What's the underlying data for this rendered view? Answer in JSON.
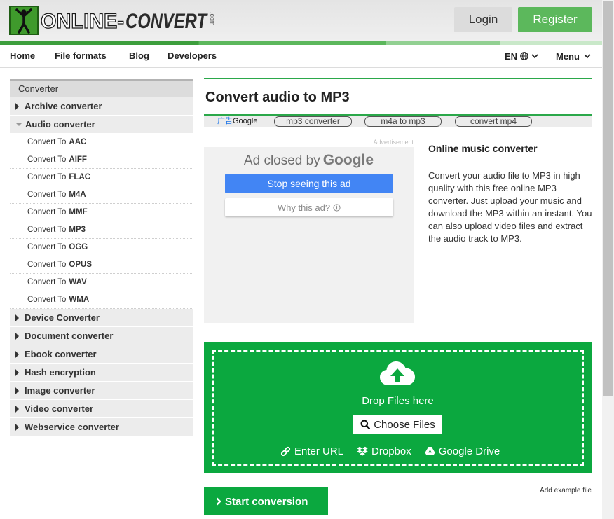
{
  "header": {
    "logo_main": "ONLINE-",
    "logo_brand": "CONVERT",
    "logo_tld": ".com",
    "login": "Login",
    "register": "Register"
  },
  "nav": {
    "home": "Home",
    "file_formats": "File formats",
    "blog": "Blog",
    "developers": "Developers",
    "language": "EN",
    "menu": "Menu"
  },
  "sidebar": {
    "title": "Converter",
    "categories": [
      {
        "label": "Archive converter",
        "expanded": false
      },
      {
        "label": "Audio converter",
        "expanded": true,
        "items": [
          {
            "prefix": "Convert To",
            "format": "AAC"
          },
          {
            "prefix": "Convert To",
            "format": "AIFF"
          },
          {
            "prefix": "Convert To",
            "format": "FLAC"
          },
          {
            "prefix": "Convert To",
            "format": "M4A"
          },
          {
            "prefix": "Convert To",
            "format": "MMF"
          },
          {
            "prefix": "Convert To",
            "format": "MP3"
          },
          {
            "prefix": "Convert To",
            "format": "OGG"
          },
          {
            "prefix": "Convert To",
            "format": "OPUS"
          },
          {
            "prefix": "Convert To",
            "format": "WAV"
          },
          {
            "prefix": "Convert To",
            "format": "WMA"
          }
        ]
      },
      {
        "label": "Device Converter",
        "expanded": false
      },
      {
        "label": "Document converter",
        "expanded": false
      },
      {
        "label": "Ebook converter",
        "expanded": false
      },
      {
        "label": "Hash encryption",
        "expanded": false
      },
      {
        "label": "Image converter",
        "expanded": false
      },
      {
        "label": "Video converter",
        "expanded": false
      },
      {
        "label": "Webservice converter",
        "expanded": false
      }
    ]
  },
  "main": {
    "title": "Convert audio to MP3",
    "ad_bar": {
      "label_cn": "广告",
      "label_google": "Google",
      "links": [
        "mp3 converter",
        "m4a to mp3",
        "convert mp4"
      ]
    },
    "ad": {
      "advertisement_label": "Advertisement",
      "closed_prefix": "Ad closed by",
      "closed_brand": "Google",
      "stop_button": "Stop seeing this ad",
      "why_button": "Why this ad?"
    },
    "info": {
      "heading": "Online music converter",
      "text": "Convert your audio file to MP3 in high quality with this free online MP3 converter. Just upload your music and download the MP3 within an instant. You can also upload video files and extract the audio track to MP3."
    },
    "upload": {
      "drop_text": "Drop Files here",
      "choose_files": "Choose Files",
      "enter_url": "Enter URL",
      "dropbox": "Dropbox",
      "google_drive": "Google Drive"
    },
    "start_conversion": "Start conversion",
    "add_example": "Add example file"
  },
  "colors": {
    "brand_green": "#0ba83f",
    "register_green": "#5cb85c",
    "ad_blue": "#4285f4",
    "divider_green": "#2ba84a"
  },
  "icons": [
    "logo-figure-icon",
    "globe-icon",
    "chevron-down-icon",
    "caret-right-icon",
    "caret-down-icon",
    "info-icon",
    "cloud-upload-icon",
    "search-icon",
    "link-icon",
    "dropbox-icon",
    "google-drive-icon",
    "chevron-right-icon"
  ]
}
